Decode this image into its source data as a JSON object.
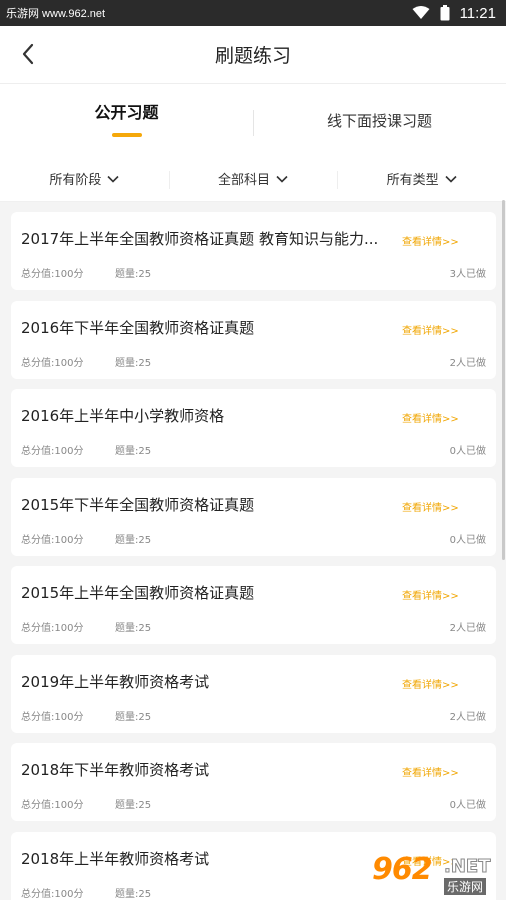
{
  "statusbar": {
    "watermark": "乐游网 www.962.net",
    "time": "11:21"
  },
  "nav": {
    "title": "刷题练习"
  },
  "tabs": [
    {
      "label": "公开习题",
      "active": true
    },
    {
      "label": "线下面授课习题",
      "active": false
    }
  ],
  "filters": [
    {
      "label": "所有阶段"
    },
    {
      "label": "全部科目"
    },
    {
      "label": "所有类型"
    }
  ],
  "items": [
    {
      "title": "2017年上半年全国教师资格证真题 教育知识与能力...",
      "detail": "查看详情>>",
      "score": "总分值:100分",
      "count": "题量:25",
      "done": "3人已做"
    },
    {
      "title": "2016年下半年全国教师资格证真题",
      "detail": "查看详情>>",
      "score": "总分值:100分",
      "count": "题量:25",
      "done": "2人已做"
    },
    {
      "title": "2016年上半年中小学教师资格",
      "detail": "查看详情>>",
      "score": "总分值:100分",
      "count": "题量:25",
      "done": "0人已做"
    },
    {
      "title": "2015年下半年全国教师资格证真题",
      "detail": "查看详情>>",
      "score": "总分值:100分",
      "count": "题量:25",
      "done": "0人已做"
    },
    {
      "title": "2015年上半年全国教师资格证真题",
      "detail": "查看详情>>",
      "score": "总分值:100分",
      "count": "题量:25",
      "done": "2人已做"
    },
    {
      "title": "2019年上半年教师资格考试",
      "detail": "查看详情>>",
      "score": "总分值:100分",
      "count": "题量:25",
      "done": "2人已做"
    },
    {
      "title": "2018年下半年教师资格考试",
      "detail": "查看详情>>",
      "score": "总分值:100分",
      "count": "题量:25",
      "done": "0人已做"
    },
    {
      "title": "2018年上半年教师资格考试",
      "detail": "查看详情>>",
      "score": "总分值:100分",
      "count": "题量:25",
      "done": ""
    }
  ],
  "logo": {
    "num": "962",
    "net": ".NET",
    "cn": "乐游网"
  },
  "colors": {
    "accent": "#f5a80a",
    "detail": "#f0a500"
  }
}
